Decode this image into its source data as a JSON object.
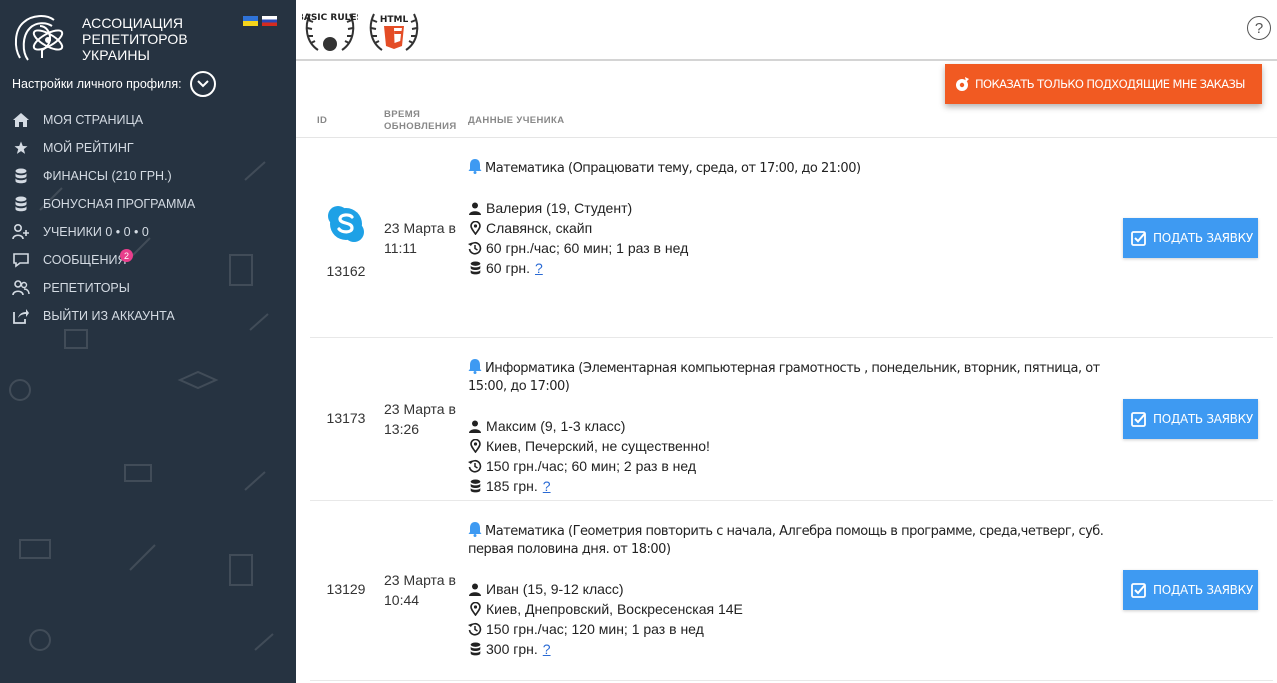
{
  "brand": {
    "logo_lines": [
      "Ассоциация",
      "репетиторов",
      "Украины"
    ]
  },
  "sidebar": {
    "profile_label": "Настройки личного профиля:",
    "items": [
      {
        "label": "Моя страница",
        "icon": "home-icon"
      },
      {
        "label": "Мой рейтинг",
        "icon": "star-icon"
      },
      {
        "label": "Финансы (210 грн.)",
        "icon": "database-icon"
      },
      {
        "label": "Бонусная программа",
        "icon": "database-icon"
      },
      {
        "label": "Ученики 0 • 0 • 0",
        "icon": "add-user-icon"
      },
      {
        "label": "Сообщения",
        "icon": "chat-icon",
        "badge": "2"
      },
      {
        "label": "Репетиторы",
        "icon": "users-icon"
      },
      {
        "label": "Выйти из аккаунта",
        "icon": "share-icon"
      }
    ]
  },
  "topbar": {
    "badges": [
      "BASIC RULES",
      "HTML"
    ],
    "help": "?"
  },
  "filter_button": {
    "label": "Показать только подходящие мне заказы"
  },
  "table": {
    "headers": {
      "id": "ID",
      "time_line1": "Время",
      "time_line2": "обновления",
      "data": "Данные ученика"
    },
    "rows": [
      {
        "id": "13162",
        "skype": true,
        "time_line1": "23 Марта в",
        "time_line2": "11:11",
        "subject": "Математика (Опрацювати тему, среда, от 17:00, до 21:00)",
        "student": "Валерия (19, Студент)",
        "location": "Славянск, скайп",
        "schedule": "60 грн./час; 60 мин; 1 раз в нед",
        "price": "60 грн.",
        "q": "?",
        "apply": "Подать заявку"
      },
      {
        "id": "13173",
        "skype": false,
        "time_line1": "23 Марта в",
        "time_line2": "13:26",
        "subject": "Информатика (Элементарная компьютерная грамотность , понедельник, вторник, пятница, от 15:00, до 17:00)",
        "student": "Максим (9, 1-3 класс)",
        "location": "Киев, Печерский, не существенно!",
        "schedule": "150 грн./час; 60 мин; 2 раз в нед",
        "price": "185 грн.",
        "q": "?",
        "apply": "Подать заявку"
      },
      {
        "id": "13129",
        "skype": false,
        "time_line1": "23 Марта в",
        "time_line2": "10:44",
        "subject": "Математика (Геометрия повторить с начала, Алгебра помощь в программе, среда,четверг, суб. первая половина дня. от 18:00)",
        "student": "Иван (15, 9-12 класс)",
        "location": "Киев, Днепровский, Воскресенская 14Е",
        "schedule": "150 грн./час; 120 мин; 1 раз в нед",
        "price": "300 грн.",
        "q": "?",
        "apply": "Подать заявку"
      }
    ]
  },
  "colors": {
    "sidebar_bg": "#263341",
    "filter_button": "#f15a22",
    "apply_button": "#3e9af2",
    "bell": "#3e9af2",
    "skype": "#1ea1e6",
    "badge": "#e83e8c"
  }
}
